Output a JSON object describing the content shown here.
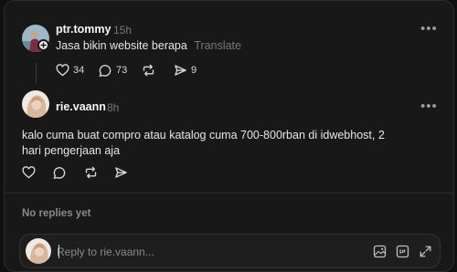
{
  "original_post": {
    "username": "ptr.tommy",
    "time": "15h",
    "text": "Jasa bikin website berapa",
    "translate_label": "Translate",
    "likes": "34",
    "comments": "73",
    "shares": "9"
  },
  "reply_post": {
    "username": "rie.vaann",
    "time": "8h",
    "text": "kalo cuma buat compro atau katalog cuma 700-800rban di idwebhost, 2 hari pengerjaan aja"
  },
  "no_replies_label": "No replies yet",
  "composer": {
    "placeholder": "Reply to rie.vaann..."
  },
  "icons": {
    "like": "heart-icon",
    "comment": "comment-icon",
    "repost": "repost-icon",
    "share": "send-icon",
    "more": "more-icon",
    "follow": "plus-icon",
    "image": "image-icon",
    "gif": "gif-icon",
    "expand": "expand-icon"
  },
  "colors": {
    "background": "#181818",
    "text": "#f3f5f7",
    "muted": "#777777"
  }
}
